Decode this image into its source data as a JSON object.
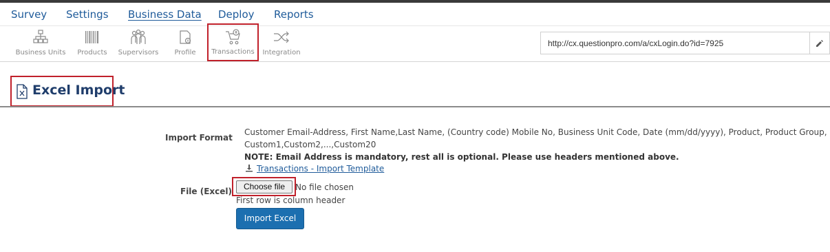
{
  "main_nav": {
    "items": [
      {
        "label": "Survey"
      },
      {
        "label": "Settings"
      },
      {
        "label": "Business Data"
      },
      {
        "label": "Deploy"
      },
      {
        "label": "Reports"
      }
    ],
    "active": "Business Data"
  },
  "sub_nav": {
    "items": [
      {
        "label": "Business Units",
        "icon": "org-chart-icon"
      },
      {
        "label": "Products",
        "icon": "barcode-icon"
      },
      {
        "label": "Supervisors",
        "icon": "people-icon"
      },
      {
        "label": "Profile",
        "icon": "profile-icon"
      },
      {
        "label": "Transactions",
        "icon": "cart-icon"
      },
      {
        "label": "Integration",
        "icon": "shuffle-icon"
      }
    ],
    "active": "Transactions"
  },
  "url_bar": {
    "value": "http://cx.questionpro.com/a/cxLogin.do?id=7925",
    "edit_icon": "pencil-icon"
  },
  "page": {
    "title": "Excel Import",
    "title_icon": "excel-file-icon"
  },
  "form": {
    "import_format_label": "Import Format",
    "import_format_line1": "Customer Email-Address, First Name,Last Name, (Country code) Mobile No, Business Unit Code, Date (mm/dd/yyyy), Product, Product Group,",
    "import_format_line2": "Custom1,Custom2,...,Custom20",
    "note": "NOTE: Email Address is mandatory, rest all is optional. Please use headers mentioned above.",
    "template_link": "Transactions - Import Template",
    "file_label": "File (Excel)",
    "choose_file": "Choose file",
    "no_file": "No file chosen",
    "header_hint": "First row is column header",
    "submit": "Import Excel"
  },
  "colors": {
    "accent": "#1f5b9a",
    "highlight": "#c0202a",
    "button": "#1c6fb0"
  }
}
